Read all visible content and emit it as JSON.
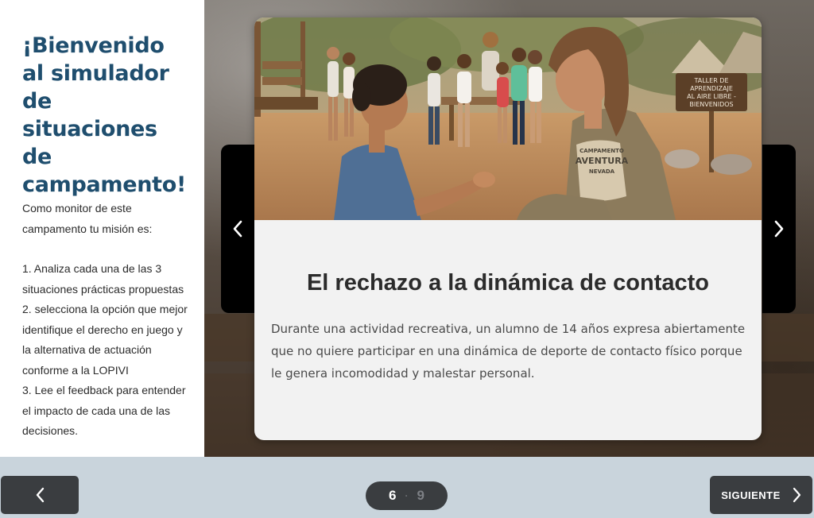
{
  "intro": {
    "title": "¡Bienvenido al simulador de situaciones de campamento!",
    "paragraph": "Como monitor de este campamento tu misión es:",
    "steps": [
      "1. Analiza cada una de las 3 situaciones prácticas propuestas",
      "2. selecciona la opción que mejor identifique el derecho en juego y la alternativa de actuación conforme a la LOPIVI",
      "3. Lee el feedback para entender el impacto de cada una de las decisiones."
    ]
  },
  "slide": {
    "title": "El rechazo a la dinámica de contacto",
    "description": "Durante una actividad recreativa, un alumno de 14 años expresa abiertamente que no quiere participar en una dinámica de deporte de contacto físico porque le genera incomodidad y malestar personal.",
    "photo": {
      "sign_lines": [
        "TALLER DE",
        "APRENDIZAJE",
        "AL AIRE LIBRE -",
        "BIENVENIDOS"
      ],
      "shirt_lines": [
        "CAMPAMENTO",
        "AVENTURA",
        "NEVADA"
      ]
    }
  },
  "pagination": {
    "current": "6",
    "separator": "·",
    "total": "9"
  },
  "navigation": {
    "next_label": "SIGUIENTE"
  },
  "icons": {
    "carousel_prev": "chevron-left-icon",
    "carousel_next": "chevron-right-icon",
    "footer_prev": "chevron-left-icon",
    "footer_next": "chevron-right-icon"
  },
  "colors": {
    "title_blue": "#1f4e6e",
    "button_dark": "#3a3d40",
    "footer_bg": "#c9d4dc",
    "card_bg": "#f2f2f2"
  }
}
